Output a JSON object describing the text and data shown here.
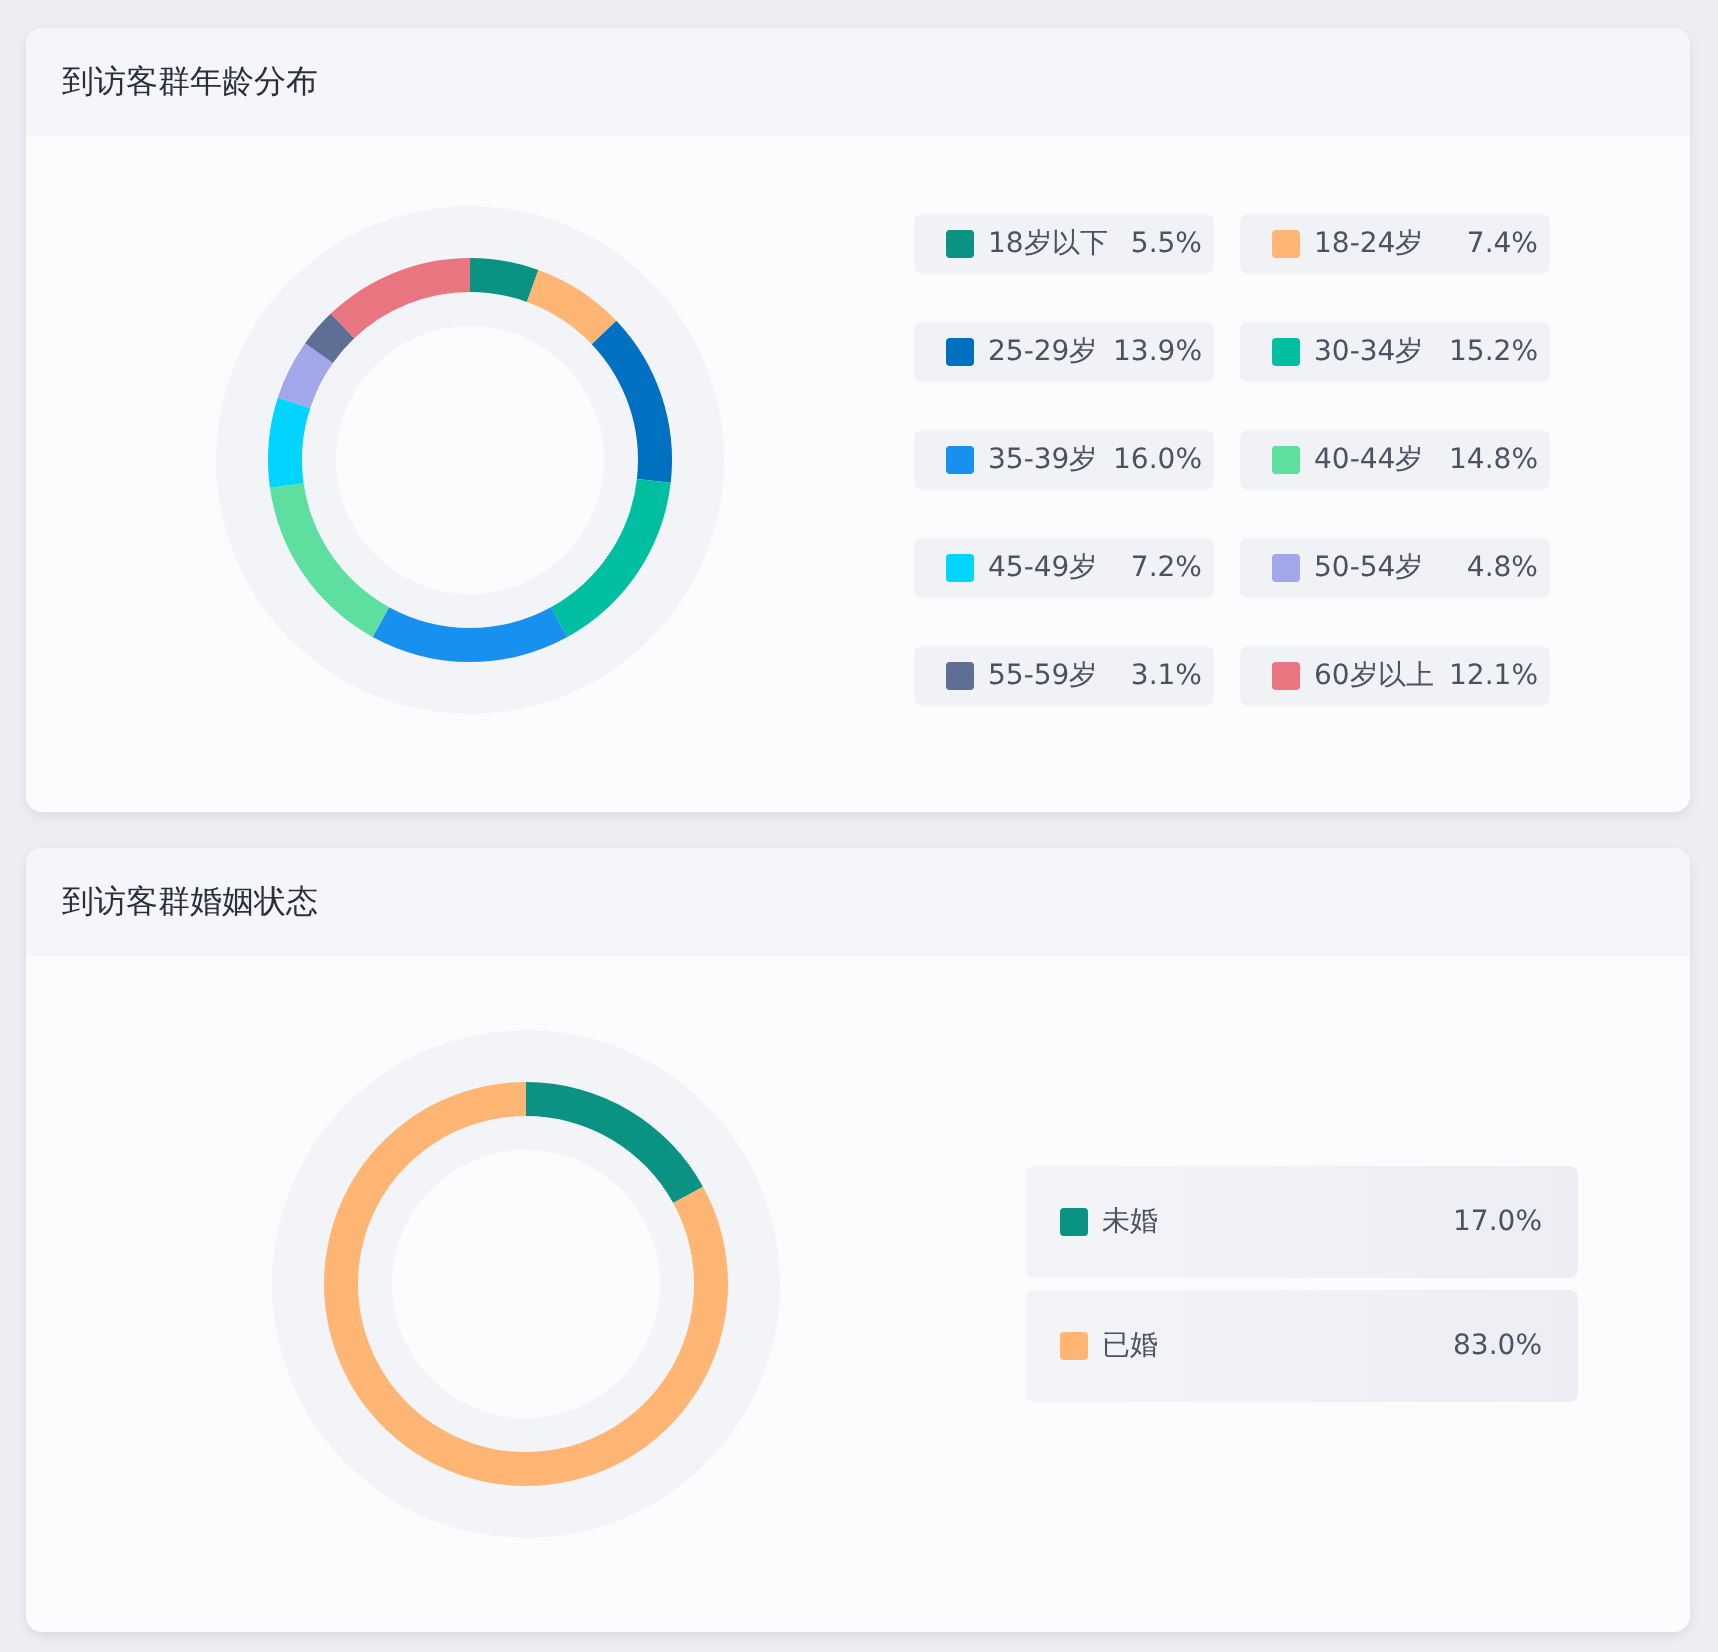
{
  "cards": [
    {
      "title": "到访客群年龄分布",
      "kind": "grid",
      "legend": [
        {
          "value": "5.5%",
          "color": "#0a9282"
        },
        {
          "value": "7.4%",
          "color": "#ffb574"
        },
        {
          "value": "13.9%",
          "color": "#0070c0"
        },
        {
          "value": "15.2%",
          "color": "#00bfa0"
        },
        {
          "value": "16.0%",
          "color": "#1890f0"
        },
        {
          "value": "14.8%",
          "color": "#5ddfa0"
        },
        {
          "value": "7.2%",
          "color": "#00d4ff"
        },
        {
          "value": "4.8%",
          "color": "#a0a8ea"
        },
        {
          "value": "3.1%",
          "color": "#5f6e95"
        },
        {
          "value": "12.1%",
          "color": "#e8757f"
        }
      ],
      "chart_data": {
        "type": "donut",
        "categories": [
          "18岁以下",
          "18-24岁",
          "25-29岁",
          "30-34岁",
          "35-39岁",
          "40-44岁",
          "45-49岁",
          "50-54岁",
          "55-59岁",
          "60岁以上"
        ],
        "values": [
          5.5,
          7.4,
          13.9,
          15.2,
          16.0,
          14.8,
          7.2,
          4.8,
          3.1,
          12.1
        ]
      }
    },
    {
      "title": "到访客群婚姻状态",
      "kind": "list",
      "legend": [
        {
          "value": "17.0%",
          "color": "#0a9282"
        },
        {
          "value": "83.0%",
          "color": "#ffb574"
        }
      ],
      "chart_data": {
        "type": "donut",
        "categories": [
          "未婚",
          "已婚"
        ],
        "values": [
          17.0,
          83.0
        ]
      }
    }
  ]
}
